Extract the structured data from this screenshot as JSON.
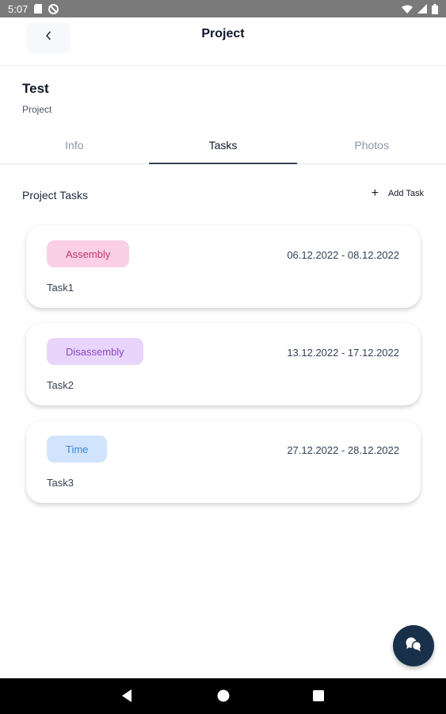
{
  "status_bar": {
    "time": "5:07",
    "left_icons": [
      "sd-card-icon",
      "no-disturb-icon"
    ],
    "right_icons": [
      "wifi-icon",
      "signal-icon",
      "battery-icon"
    ]
  },
  "app_bar": {
    "title": "Project",
    "back_icon": "chevron-left-icon"
  },
  "project": {
    "name": "Test",
    "type": "Project"
  },
  "tabs": [
    {
      "label": "Info",
      "active": false
    },
    {
      "label": "Tasks",
      "active": true
    },
    {
      "label": "Photos",
      "active": false
    }
  ],
  "section": {
    "title": "Project Tasks",
    "add_label": "Add Task",
    "add_icon": "plus-icon"
  },
  "tasks": [
    {
      "category": "Assembly",
      "category_bg": "#fbd0e7",
      "category_fg": "#c2366f",
      "dates": "06.12.2022 - 08.12.2022",
      "name": "Task1"
    },
    {
      "category": "Disassembly",
      "category_bg": "#e9d5fb",
      "category_fg": "#8b46c9",
      "dates": "13.12.2022 - 17.12.2022",
      "name": "Task2"
    },
    {
      "category": "Time",
      "category_bg": "#d2e4fd",
      "category_fg": "#3b82d6",
      "dates": "27.12.2022 - 28.12.2022",
      "name": "Task3"
    }
  ],
  "fab": {
    "icon": "chat-icon",
    "color": "#183049"
  },
  "nav_bar": {
    "icons": [
      "back-triangle-icon",
      "home-circle-icon",
      "recents-square-icon"
    ]
  }
}
